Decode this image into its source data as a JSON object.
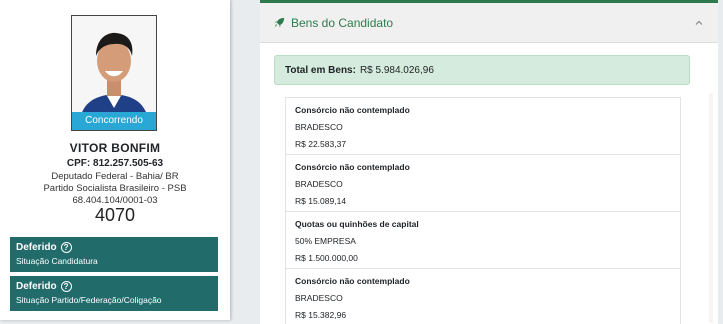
{
  "candidate": {
    "status_label": "Concorrendo",
    "name": "VITOR BONFIM",
    "cpf": "CPF: 812.257.505-63",
    "position": "Deputado Federal - Bahia/ BR",
    "party": "Partido Socialista Brasileiro - PSB",
    "cnpj": "68.404.104/0001-03",
    "number": "4070"
  },
  "statuses": [
    {
      "title": "Deferido",
      "subtitle": "Situação Candidatura"
    },
    {
      "title": "Deferido",
      "subtitle": "Situação Partido/Federação/Coligação"
    }
  ],
  "assets_panel": {
    "title": "Bens do Candidato",
    "total_label": "Total em Bens:",
    "total_value": "R$ 5.984.026,96",
    "items": [
      {
        "type": "Consórcio não contemplado",
        "institution": "BRADESCO",
        "value": "R$ 22.583,37"
      },
      {
        "type": "Consórcio não contemplado",
        "institution": "BRADESCO",
        "value": "R$ 15.089,14"
      },
      {
        "type": "Quotas ou quinhões de capital",
        "institution": "50% EMPRESA",
        "value": "R$ 1.500.000,00"
      },
      {
        "type": "Consórcio não contemplado",
        "institution": "BRADESCO",
        "value": "R$ 15.382,96"
      }
    ]
  },
  "icons": {
    "header": "rocket-icon",
    "collapse": "chevron-up-icon",
    "help": "question-circle-icon"
  },
  "colors": {
    "accent_green": "#2f7a4c",
    "status_teal": "#216b6b",
    "ribbon_blue": "#29a8d6",
    "total_bg": "#d5ebdd"
  }
}
